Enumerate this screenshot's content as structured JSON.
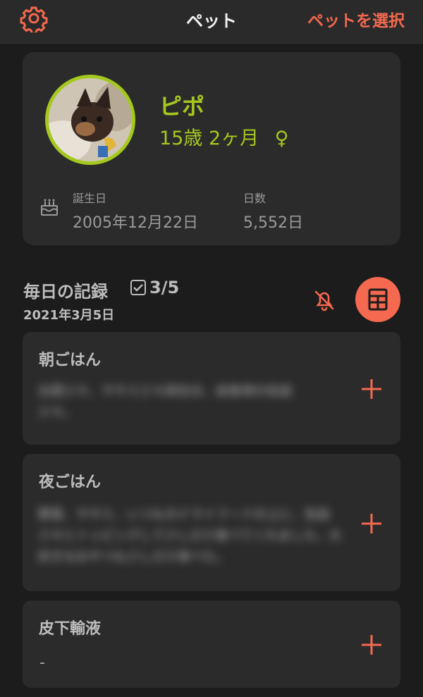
{
  "nav": {
    "title": "ペット",
    "action_label": "ペットを選択"
  },
  "pet": {
    "name": "ピポ",
    "age": "15歳 2ヶ月",
    "sex_symbol": "♀",
    "birthday_label": "誕生日",
    "birthday": "2005年12月22日",
    "days_label": "日数",
    "days": "5,552日"
  },
  "records": {
    "title": "毎日の記録",
    "count": "3/5",
    "date": "2021年3月5日",
    "items": [
      {
        "title": "朝ごはん",
        "note": "白菜少々、ササミ少々卵白分、試食用の缶詰少々。"
      },
      {
        "title": "夜ごはん",
        "note": "野菜、ササミ、いつものドライフードの上に、缶詰少々とトッピングして少しだけ食べてくれました。大好きなおやつも少しだけ食べた。"
      },
      {
        "title": "皮下輸液",
        "note": "-"
      }
    ]
  },
  "colors": {
    "accent": "#f4694f",
    "pet_green": "#a5c81e",
    "background": "#1c1c1c",
    "card": "#2b2b2b"
  }
}
